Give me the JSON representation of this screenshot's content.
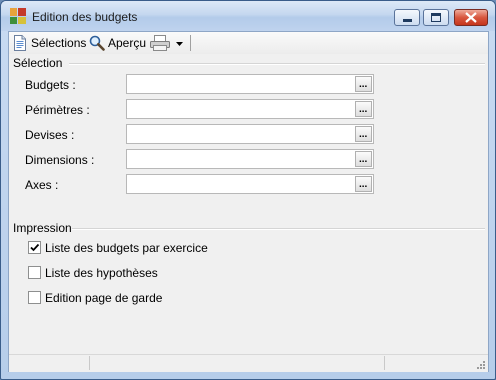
{
  "window": {
    "title": "Edition des budgets"
  },
  "toolbar": {
    "selections_label": "Sélections",
    "apercu_label": "Aperçu"
  },
  "selection": {
    "group_label": "Sélection",
    "fields": [
      {
        "label": "Budgets :",
        "value": "",
        "button": "..."
      },
      {
        "label": "Périmètres :",
        "value": "",
        "button": "..."
      },
      {
        "label": "Devises :",
        "value": "",
        "button": "..."
      },
      {
        "label": "Dimensions :",
        "value": "",
        "button": "..."
      },
      {
        "label": "Axes :",
        "value": "",
        "button": "..."
      }
    ]
  },
  "impression": {
    "group_label": "Impression",
    "options": [
      {
        "label": "Liste des budgets par exercice",
        "checked": true
      },
      {
        "label": "Liste des hypothèses",
        "checked": false
      },
      {
        "label": "Edition page de garde",
        "checked": false
      }
    ]
  },
  "icons": {
    "app": "app-icon",
    "selections": "document-icon",
    "apercu": "magnifier-icon",
    "print": "printer-icon",
    "dropdown": "chevron-down-icon"
  },
  "colors": {
    "close_button": "#c5351c",
    "titlebar": "#c4d7ef",
    "client_background": "#f0f0f0"
  }
}
